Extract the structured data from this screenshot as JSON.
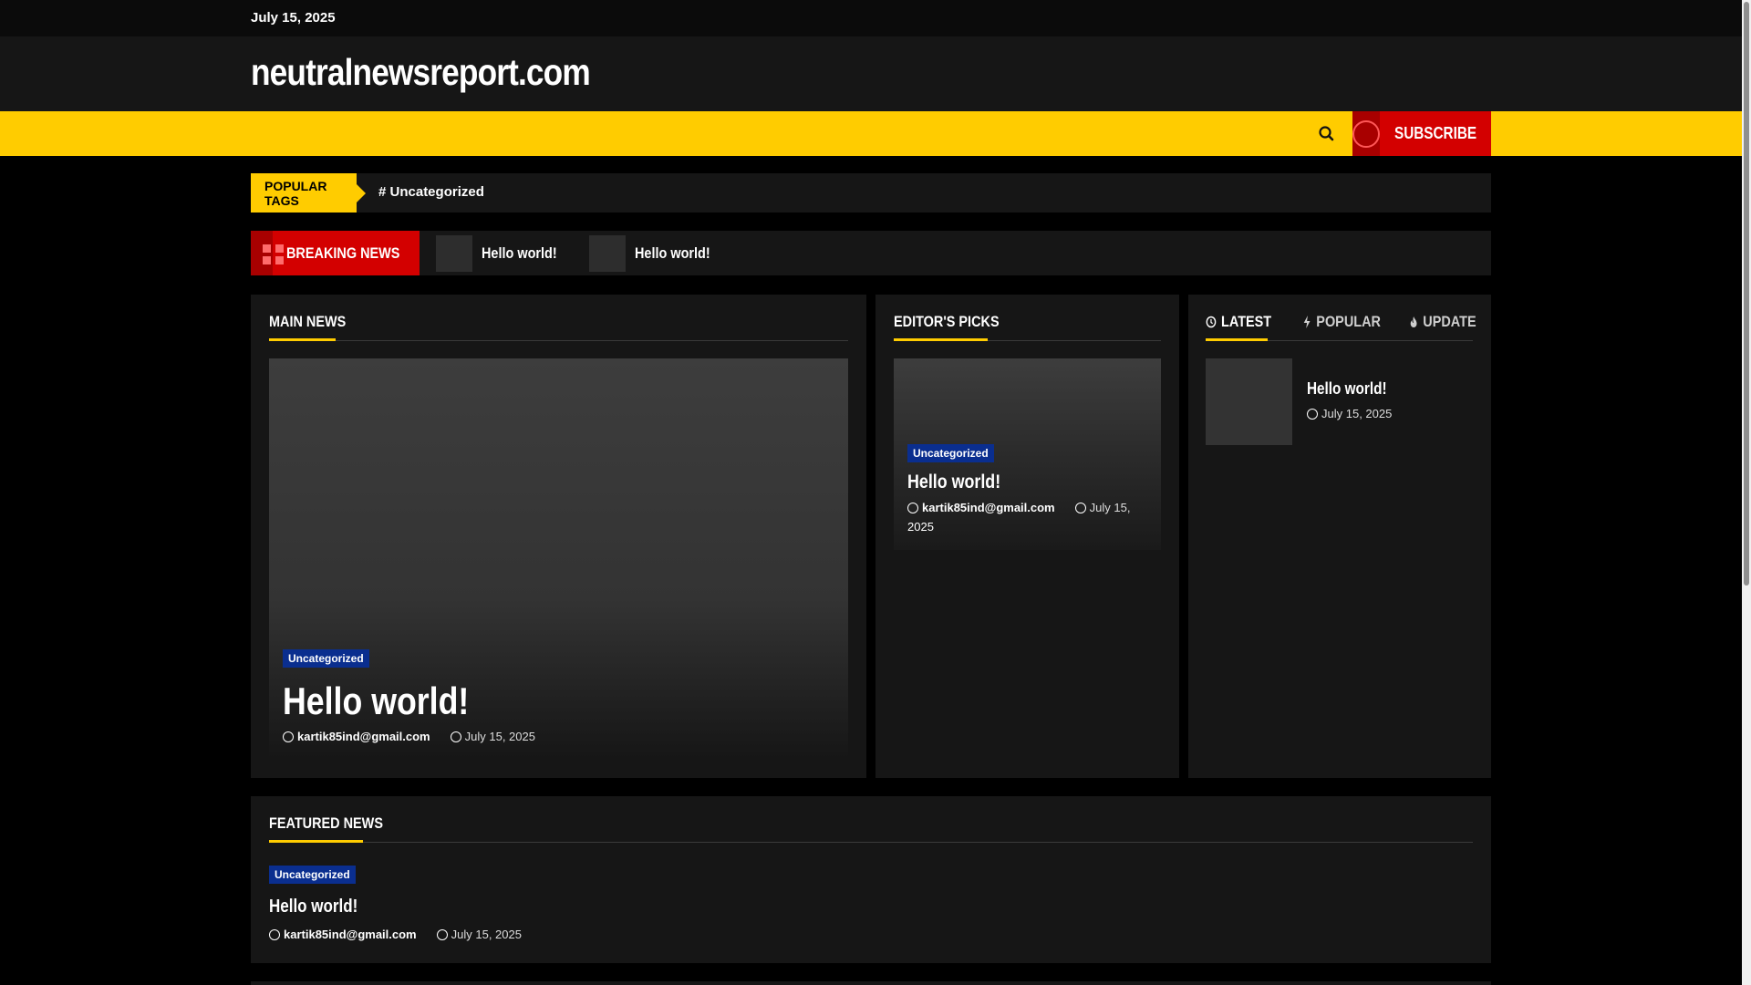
{
  "topbar": {
    "date": "July 15, 2025"
  },
  "header": {
    "site_title": "neutralnewsreport.com"
  },
  "nav": {
    "subscribe_label": "SUBSCRIBE",
    "search_icon": "search-icon",
    "subscribe_icon": "circle-icon"
  },
  "popular_tags": {
    "label": "POPULAR TAGS",
    "items": [
      "# Uncategorized"
    ]
  },
  "breaking_news": {
    "label": "BREAKING NEWS",
    "items": [
      "Hello world!",
      "Hello world!"
    ]
  },
  "main_news": {
    "heading": "MAIN NEWS",
    "post": {
      "category": "Uncategorized",
      "title": "Hello world!",
      "author": "kartik85ind@gmail.com",
      "date": "July 15, 2025"
    }
  },
  "editors_picks": {
    "heading": "EDITOR'S PICKS",
    "post": {
      "category": "Uncategorized",
      "title": "Hello world!",
      "author": "kartik85ind@gmail.com",
      "date_line1": "July 15,",
      "date_line2": "2025"
    }
  },
  "tabs": {
    "items": [
      "LATEST",
      "POPULAR",
      "UPDATE"
    ],
    "active": "LATEST",
    "latest_post": {
      "title": "Hello world!",
      "date": "July 15, 2025"
    }
  },
  "featured_news": {
    "heading": "FEATURED NEWS",
    "post": {
      "category": "Uncategorized",
      "title": "Hello world!",
      "author": "kartik85ind@gmail.com",
      "date": "July 15, 2025"
    }
  },
  "colors": {
    "accent": "#ffcc00",
    "breaking": "#d30000",
    "category": "#0a2e8f",
    "panel": "#161616"
  }
}
